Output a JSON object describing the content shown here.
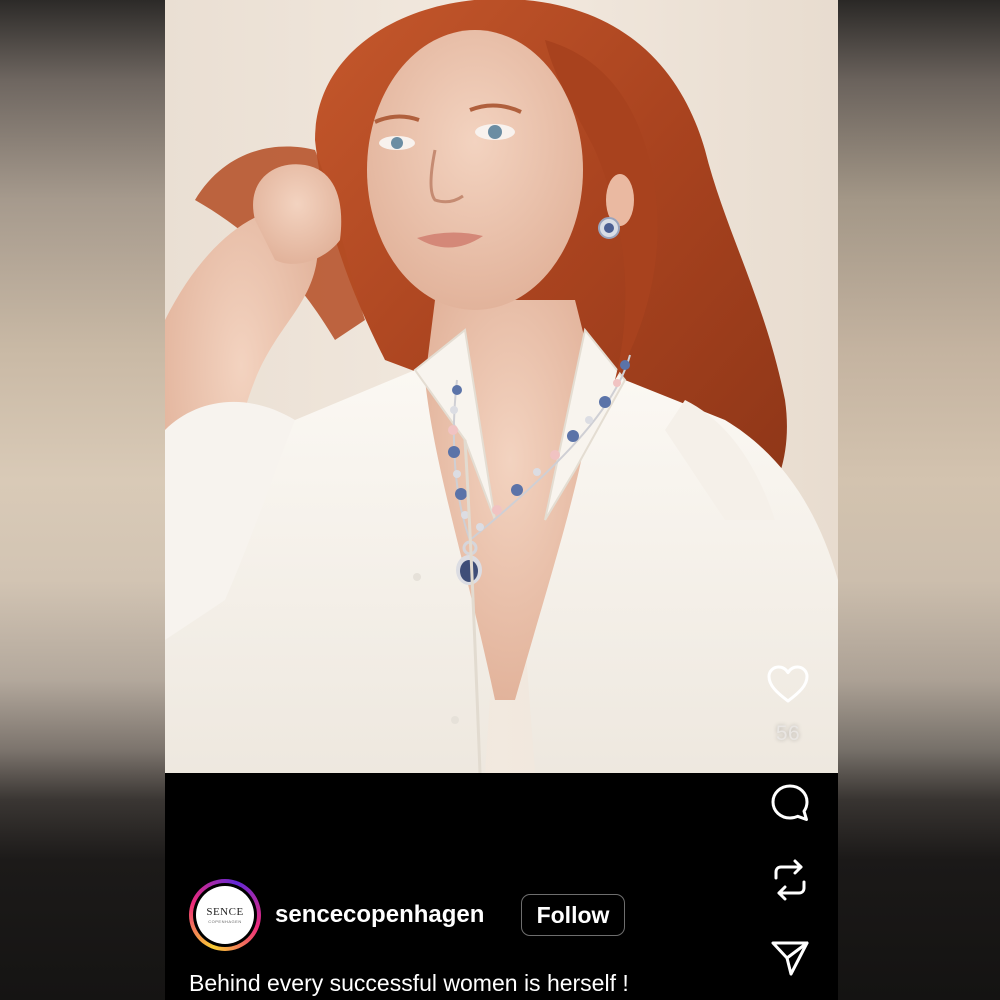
{
  "post": {
    "image_alt": "Model with red hair wearing a white shirt, a blue and pink beaded necklace with pendant, and stud earrings"
  },
  "actions": {
    "like_count": "56",
    "like_icon": "heart-outline-icon",
    "comment_icon": "comment-bubble-icon",
    "repost_icon": "repost-arrows-icon",
    "share_icon": "send-paper-plane-icon"
  },
  "account": {
    "avatar_logo_text": "SENCE",
    "avatar_logo_sub": "COPENHAGEN",
    "username": "sencecopenhagen",
    "follow_label": "Follow"
  },
  "caption": {
    "text": "Behind every successful women is herself !"
  },
  "colors": {
    "background": "#000000",
    "text": "#ffffff",
    "follow_border": "#6e6e6e",
    "story_ring": [
      "#f9ce34",
      "#ee2a7b",
      "#6228d7"
    ]
  }
}
